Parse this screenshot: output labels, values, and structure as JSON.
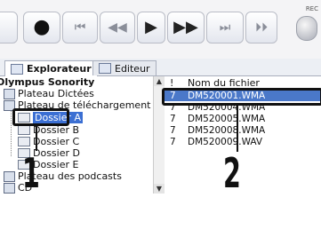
{
  "toolbar": {
    "buttons": [
      {
        "name": "record",
        "glyph": "●"
      },
      {
        "name": "skip-back",
        "glyph": "⏮"
      },
      {
        "name": "rewind",
        "glyph": "◀◀"
      },
      {
        "name": "play",
        "glyph": "▶"
      },
      {
        "name": "fast-forward",
        "glyph": "▶▶"
      },
      {
        "name": "skip-forward",
        "glyph": "⏭"
      },
      {
        "name": "index",
        "glyph": "⏵⏵"
      }
    ],
    "rec_label": "REC"
  },
  "tabs": [
    {
      "label": "Explorateur",
      "active": true
    },
    {
      "label": "Editeur",
      "active": false
    }
  ],
  "tree": {
    "root": "Olympus Sonority",
    "items": [
      {
        "label": "Plateau Dictées",
        "level": 1
      },
      {
        "label": "Plateau de téléchargement",
        "level": 1
      },
      {
        "label": "Dossier A",
        "level": 2,
        "selected": true
      },
      {
        "label": "Dossier B",
        "level": 2
      },
      {
        "label": "Dossier C",
        "level": 2
      },
      {
        "label": "Dossier D",
        "level": 2
      },
      {
        "label": "Dossier E",
        "level": 2
      },
      {
        "label": "Plateau des podcasts",
        "level": 1
      },
      {
        "label": "CD",
        "level": 1
      }
    ]
  },
  "file_list": {
    "column_headers": [
      "!",
      "Nom du fichier"
    ],
    "rows": [
      {
        "col1": "7",
        "name": "DM520001.WMA",
        "selected": true
      },
      {
        "col1": "7",
        "name": "DM520004.WMA"
      },
      {
        "col1": "7",
        "name": "DM520005.WMA"
      },
      {
        "col1": "7",
        "name": "DM520008.WMA"
      },
      {
        "col1": "7",
        "name": "DM520009.WAV"
      }
    ]
  },
  "callouts": [
    "1",
    "2"
  ],
  "colors": {
    "selection": "#3b6fd3",
    "callout": "#111111"
  }
}
